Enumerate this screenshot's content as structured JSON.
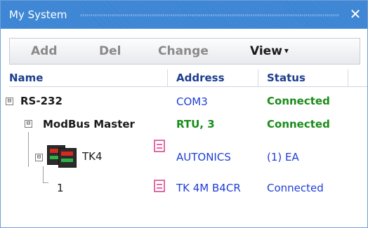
{
  "window": {
    "title": "My System",
    "close_glyph": "✕"
  },
  "toolbar": {
    "add_label": "Add",
    "del_label": "Del",
    "change_label": "Change",
    "view_label": "View",
    "view_caret": "▾"
  },
  "columns": {
    "name": "Name",
    "address": "Address",
    "status": "Status"
  },
  "rows": [
    {
      "name": "RS-232",
      "address": "COM3",
      "status": "Connected",
      "expander": "⊟"
    },
    {
      "name": "ModBus Master",
      "address": "RTU, 3",
      "status": "Connected",
      "expander": "⊟"
    },
    {
      "name": "TK4",
      "address": "AUTONICS",
      "status": "(1) EA",
      "expander": "⊟"
    },
    {
      "name": "1",
      "address": "TK 4M B4CR",
      "status": "Connected"
    }
  ],
  "colors": {
    "titlebar": "#3a84d4",
    "header_text": "#1d3f8f",
    "green": "#1a8c1a",
    "blue": "#1f3fd6",
    "icon_pink": "#e46aa6"
  }
}
